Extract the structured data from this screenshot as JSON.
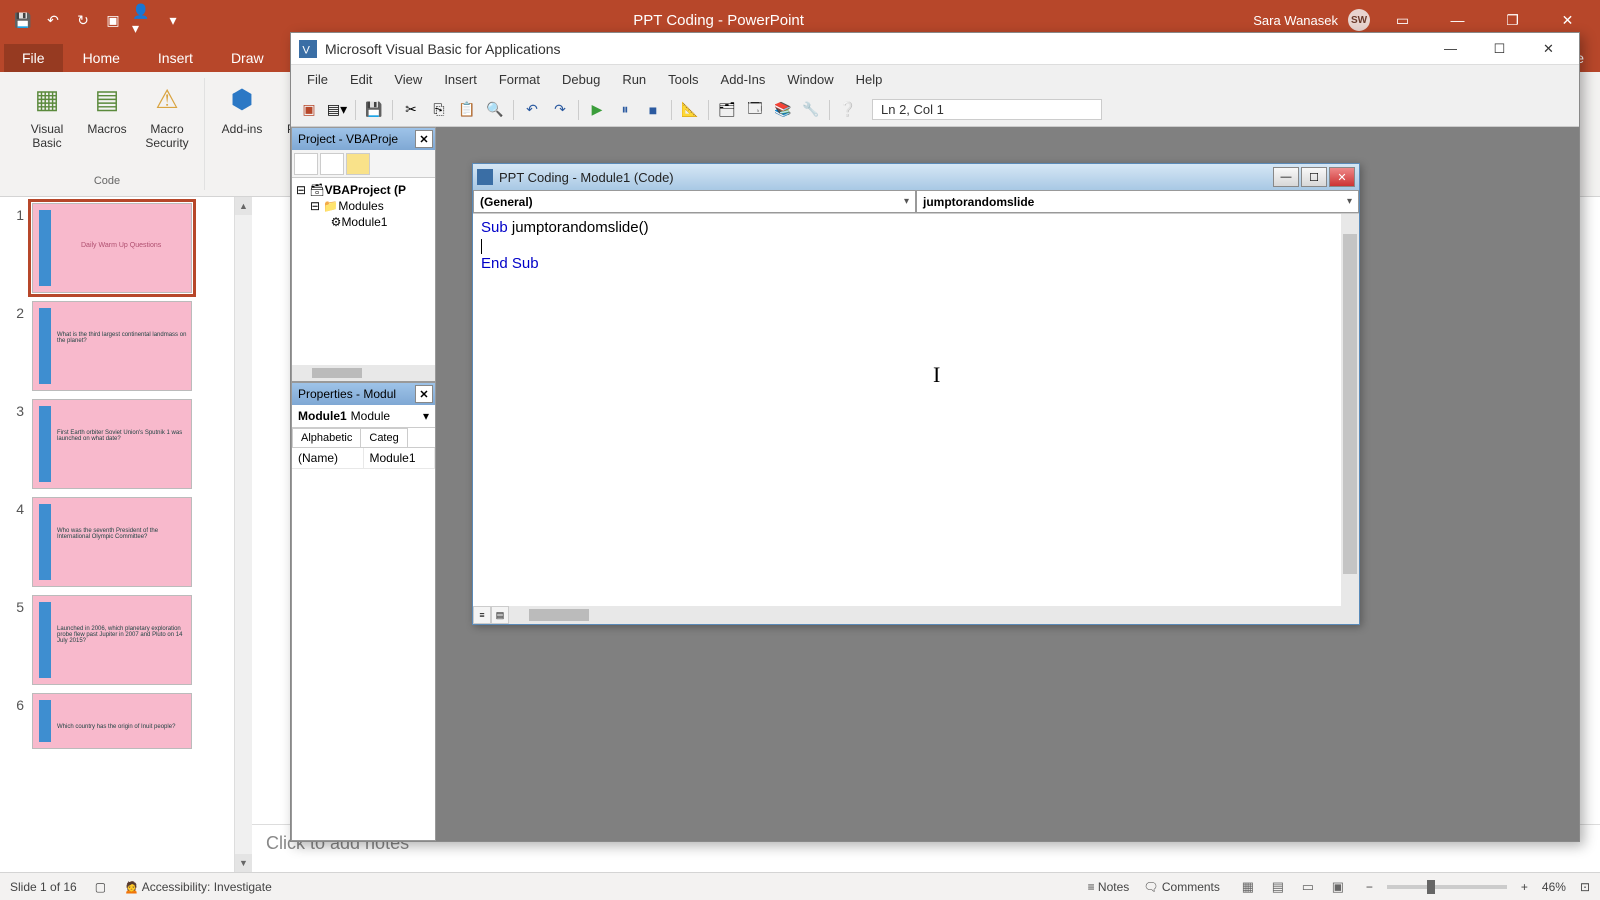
{
  "ppt": {
    "title": "PPT Coding  -  PowerPoint",
    "user_name": "Sara Wanasek",
    "user_initials": "SW",
    "tabs": {
      "file": "File",
      "home": "Home",
      "insert": "Insert",
      "draw": "Draw"
    },
    "share": "are",
    "ribbon": {
      "visual_basic": "Visual Basic",
      "macros": "Macros",
      "macro_security": "Macro Security",
      "code_group": "Code",
      "addins": "Add-ins",
      "power": "Powe",
      "add": "Add"
    }
  },
  "thumbs": [
    {
      "num": "1",
      "text": "Daily Warm Up Questions",
      "selected": true
    },
    {
      "num": "2",
      "text": "What is the third largest continental landmass on the planet?"
    },
    {
      "num": "3",
      "text": "First Earth orbiter Soviet Union's Sputnik 1 was launched on what date?"
    },
    {
      "num": "4",
      "text": "Who was the seventh President of the International Olympic Committee?"
    },
    {
      "num": "5",
      "text": "Launched in 2006, which planetary exploration probe flew past Jupiter in 2007 and Pluto on 14 July 2015?"
    },
    {
      "num": "6",
      "text": "Which country has the origin of Inuit people?"
    }
  ],
  "notes_placeholder": "Click to add notes",
  "status": {
    "slide": "Slide 1 of 16",
    "accessibility": "Accessibility: Investigate",
    "notes": "Notes",
    "comments": "Comments",
    "zoom": "46%"
  },
  "vbe": {
    "title": "Microsoft Visual Basic for Applications",
    "menus": [
      "File",
      "Edit",
      "View",
      "Insert",
      "Format",
      "Debug",
      "Run",
      "Tools",
      "Add-Ins",
      "Window",
      "Help"
    ],
    "cursor_pos": "Ln 2, Col 1",
    "project_pane_title": "Project - VBAProje",
    "project_root": "VBAProject (P",
    "modules_folder": "Modules",
    "module1": "Module1",
    "props_pane_title": "Properties - Modul",
    "props_object": "Module1",
    "props_type": "Module",
    "props_tab_alpha": "Alphabetic",
    "props_tab_cat": "Categ",
    "props_name_key": "(Name)",
    "props_name_val": "Module1"
  },
  "code_win": {
    "title": "PPT Coding - Module1 (Code)",
    "dd_left": "(General)",
    "dd_right": "jumptorandomslide",
    "line1_kw": "Sub ",
    "line1_rest": "jumptorandomslide()",
    "line3": "End Sub"
  }
}
